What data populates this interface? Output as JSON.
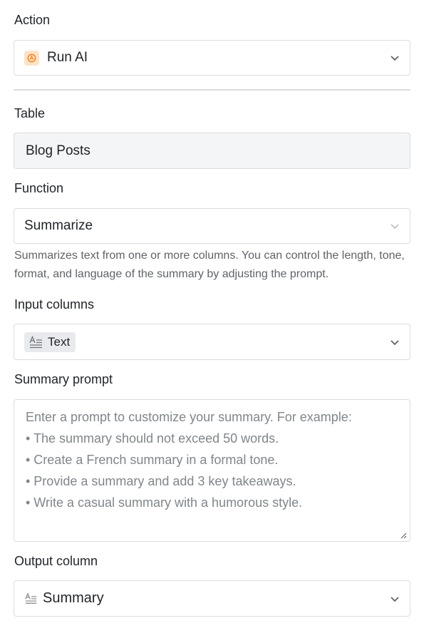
{
  "action": {
    "label": "Action",
    "value": "Run AI",
    "icon": "ai-assistant-icon",
    "icon_color": "#f5a04a"
  },
  "table": {
    "label": "Table",
    "value": "Blog Posts"
  },
  "function": {
    "label": "Function",
    "value": "Summarize",
    "description": "Summarizes text from one or more columns. You can control the length, tone, format, and language of the summary by adjusting the prompt."
  },
  "input_columns": {
    "label": "Input columns",
    "chips": [
      {
        "icon": "long-text-icon",
        "label": "Text"
      }
    ]
  },
  "summary_prompt": {
    "label": "Summary prompt",
    "placeholder_lines": [
      "Enter a prompt to customize your summary. For example:",
      "• The summary should not exceed 50 words.",
      "• Create a French summary in a formal tone.",
      "• Provide a summary and add 3 key takeaways.",
      "• Write a casual summary with a humorous style."
    ]
  },
  "output_column": {
    "label": "Output column",
    "value": "Summary",
    "icon": "long-text-icon"
  },
  "colors": {
    "border": "#dadce0",
    "disabled_bg": "#f4f5f6",
    "placeholder": "#80868b",
    "chip_bg": "#e8eaed"
  }
}
